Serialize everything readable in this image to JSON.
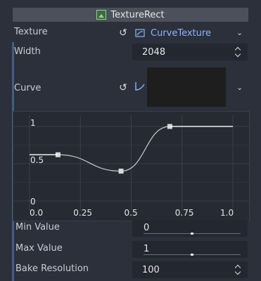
{
  "header": {
    "title": "TextureRect",
    "icon": "texture-rect-icon"
  },
  "properties": {
    "texture": {
      "label": "Texture",
      "value": "CurveTexture",
      "value_color": "#8ab8ff"
    },
    "width": {
      "label": "Width",
      "value": "2048"
    },
    "curve": {
      "label": "Curve"
    },
    "min_value": {
      "label": "Min Value",
      "value": "0",
      "slider_fraction": 0.5
    },
    "max_value": {
      "label": "Max Value",
      "value": "1",
      "slider_fraction": 0.5
    },
    "bake_resolution": {
      "label": "Bake Resolution",
      "value": "100"
    }
  },
  "chart_data": {
    "type": "line",
    "x_ticks": [
      "0.0",
      "0.25",
      "0.5",
      "0.75",
      "1.0"
    ],
    "y_ticks": [
      "0",
      "0.5",
      "1"
    ],
    "xlim": [
      0,
      1
    ],
    "ylim": [
      0,
      1
    ],
    "points": [
      {
        "x": 0.0,
        "y": 0.62
      },
      {
        "x": 0.14,
        "y": 0.62
      },
      {
        "x": 0.45,
        "y": 0.4
      },
      {
        "x": 0.69,
        "y": 1.0
      },
      {
        "x": 1.0,
        "y": 1.0
      }
    ],
    "grid": true
  }
}
